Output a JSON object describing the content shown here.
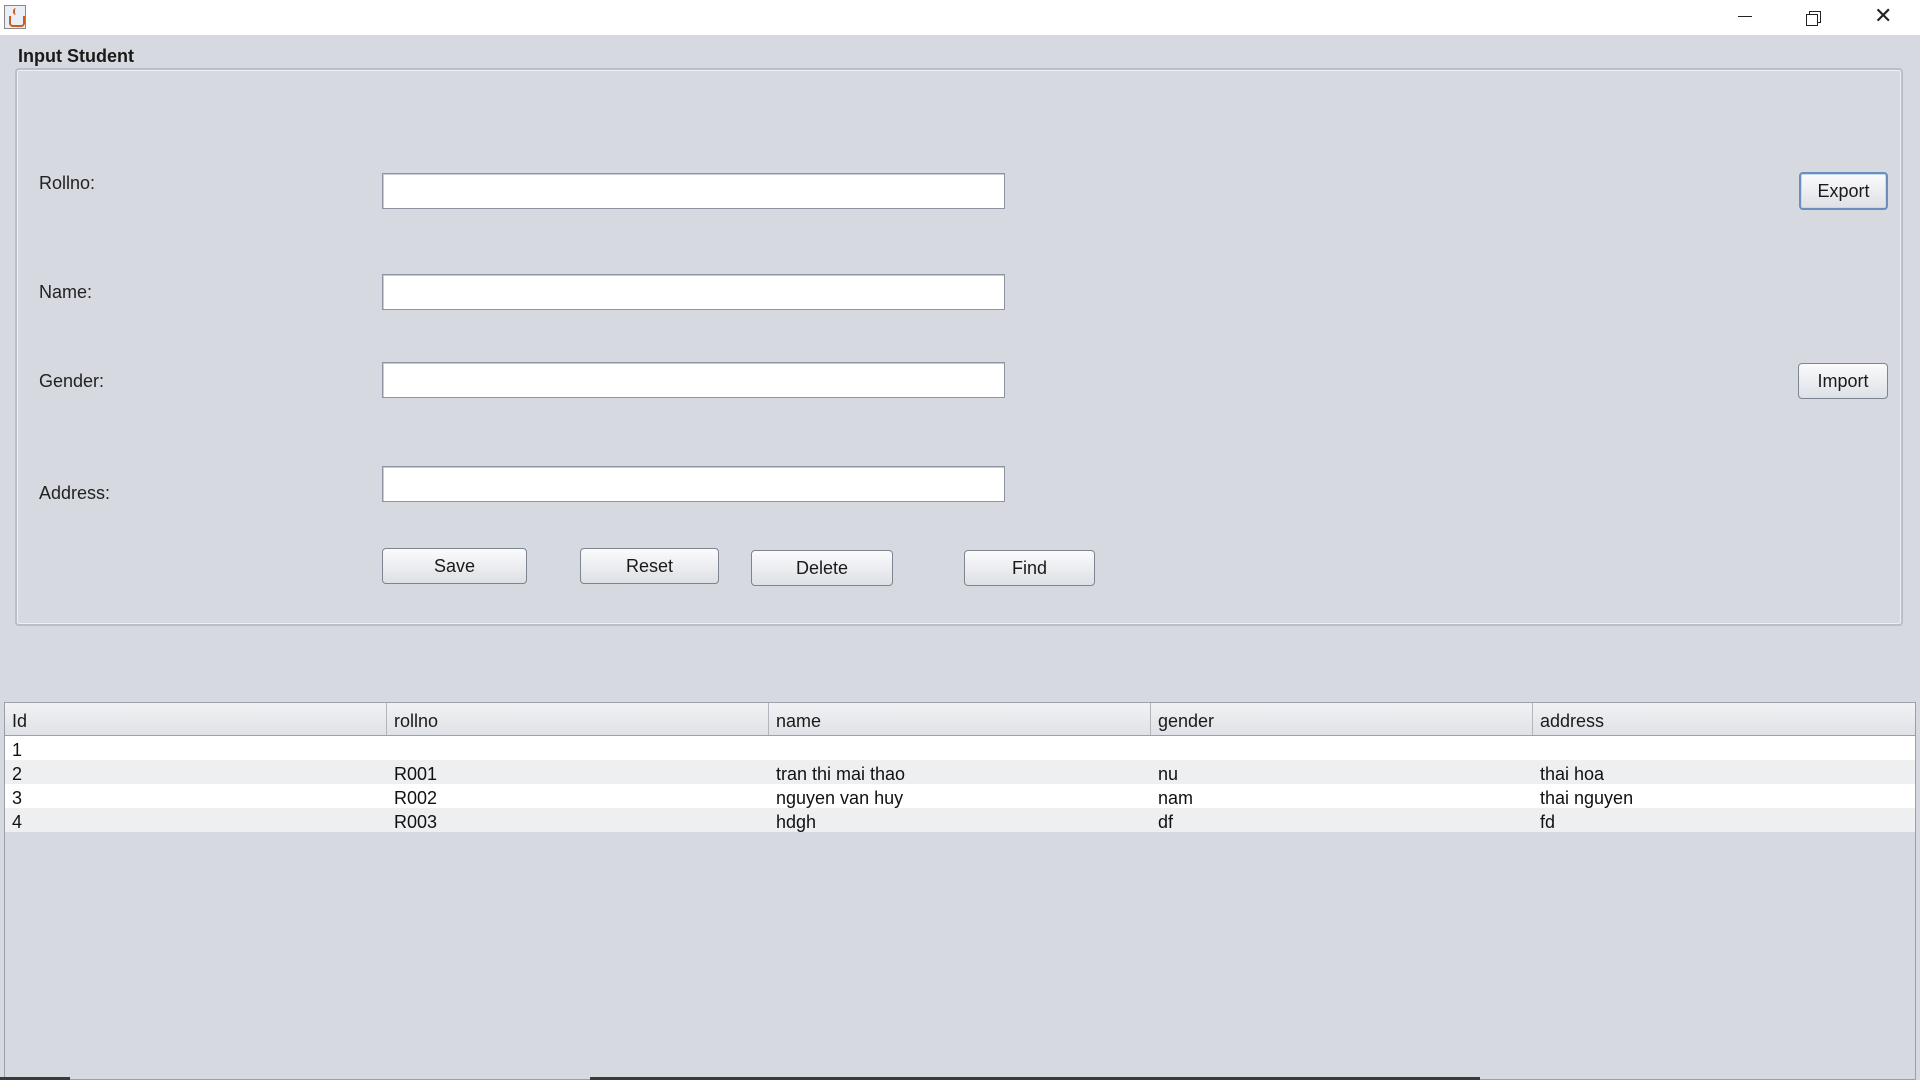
{
  "window": {
    "icon": "java-cup-icon",
    "controls": [
      "minimize-icon",
      "restore-icon",
      "close-icon"
    ],
    "close_glyph": "✕"
  },
  "form": {
    "title": "Input Student",
    "fields": [
      {
        "label": "Rollno:",
        "value": ""
      },
      {
        "label": "Name:",
        "value": ""
      },
      {
        "label": "Gender:",
        "value": ""
      },
      {
        "label": "Address:",
        "value": ""
      }
    ],
    "buttons": {
      "save": "Save",
      "reset": "Reset",
      "delete": "Delete",
      "find": "Find",
      "export": "Export",
      "import": "Import"
    }
  },
  "table": {
    "columns": [
      "Id",
      "rollno",
      "name",
      "gender",
      "address"
    ],
    "rows": [
      [
        "1",
        "",
        "",
        "",
        ""
      ],
      [
        "2",
        "R001",
        "tran thi mai thao",
        "nu",
        "thai hoa"
      ],
      [
        "3",
        "R002",
        "nguyen van huy",
        "nam",
        "thai nguyen"
      ],
      [
        "4",
        "R003",
        "hdgh",
        "df",
        "fd"
      ]
    ]
  },
  "colors": {
    "background": "#d6d9df",
    "focus_border": "#6a8fbf"
  }
}
